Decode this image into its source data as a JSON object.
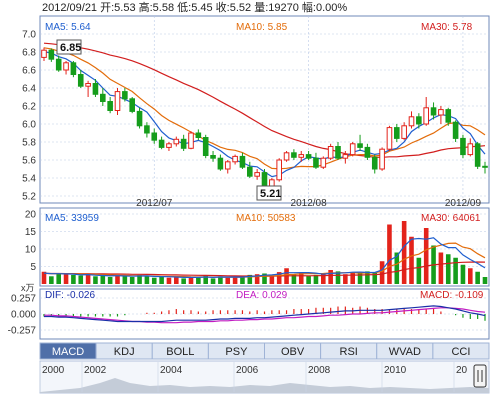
{
  "header": {
    "text": "2012/09/21 开:5.53 高:5.58 低:5.45 收:5.52 量:19270 幅:0.00%"
  },
  "colors": {
    "up": "#e3231b",
    "down": "#159d1b",
    "ma5": "#1f5fcf",
    "ma10": "#e36c0a",
    "ma30": "#d21e1e",
    "dif": "#1a2fa8",
    "dea": "#c21cc2",
    "grid": "#b9c9e6",
    "axis": "#6f88b8"
  },
  "chart_data": [
    {
      "type": "candlestick",
      "name": "price",
      "ma_labels": {
        "ma5": "MA5: 5.64",
        "ma10": "MA10: 5.85",
        "ma30": "MA30: 5.78"
      },
      "ylim": [
        5.2,
        7.0
      ],
      "yticks": [
        "7.0",
        "6.8",
        "6.6",
        "6.4",
        "6.2",
        "6.0",
        "5.8",
        "5.6",
        "5.4",
        "5.2"
      ],
      "xticks": [
        "2012/07",
        "2012/08",
        "2012/09"
      ],
      "annotations": {
        "high": "6.85",
        "low": "5.21"
      },
      "candles": [
        [
          6.74,
          6.85,
          6.7,
          6.82
        ],
        [
          6.82,
          6.84,
          6.69,
          6.72
        ],
        [
          6.72,
          6.76,
          6.58,
          6.6
        ],
        [
          6.6,
          6.7,
          6.55,
          6.68
        ],
        [
          6.68,
          6.7,
          6.52,
          6.55
        ],
        [
          6.55,
          6.6,
          6.4,
          6.42
        ],
        [
          6.42,
          6.48,
          6.3,
          6.45
        ],
        [
          6.45,
          6.5,
          6.3,
          6.33
        ],
        [
          6.33,
          6.4,
          6.2,
          6.25
        ],
        [
          6.25,
          6.3,
          6.12,
          6.15
        ],
        [
          6.15,
          6.4,
          6.1,
          6.36
        ],
        [
          6.36,
          6.4,
          6.25,
          6.28
        ],
        [
          6.28,
          6.3,
          6.12,
          6.14
        ],
        [
          6.14,
          6.18,
          5.95,
          5.98
        ],
        [
          5.98,
          6.02,
          5.85,
          5.9
        ],
        [
          5.9,
          5.95,
          5.78,
          5.82
        ],
        [
          5.82,
          5.86,
          5.72,
          5.74
        ],
        [
          5.74,
          5.8,
          5.7,
          5.78
        ],
        [
          5.78,
          5.86,
          5.75,
          5.83
        ],
        [
          5.83,
          5.88,
          5.7,
          5.73
        ],
        [
          5.73,
          5.92,
          5.72,
          5.9
        ],
        [
          5.9,
          5.94,
          5.82,
          5.85
        ],
        [
          5.85,
          5.88,
          5.62,
          5.65
        ],
        [
          5.65,
          5.7,
          5.58,
          5.62
        ],
        [
          5.62,
          5.66,
          5.48,
          5.5
        ],
        [
          5.5,
          5.6,
          5.45,
          5.58
        ],
        [
          5.58,
          5.66,
          5.55,
          5.64
        ],
        [
          5.64,
          5.68,
          5.5,
          5.52
        ],
        [
          5.52,
          5.58,
          5.4,
          5.42
        ],
        [
          5.42,
          5.5,
          5.38,
          5.46
        ],
        [
          5.46,
          5.5,
          5.28,
          5.3
        ],
        [
          5.3,
          5.4,
          5.21,
          5.38
        ],
        [
          5.38,
          5.62,
          5.36,
          5.6
        ],
        [
          5.6,
          5.7,
          5.58,
          5.68
        ],
        [
          5.68,
          5.72,
          5.6,
          5.63
        ],
        [
          5.63,
          5.7,
          5.58,
          5.66
        ],
        [
          5.66,
          5.7,
          5.6,
          5.62
        ],
        [
          5.62,
          5.68,
          5.5,
          5.52
        ],
        [
          5.52,
          5.64,
          5.5,
          5.62
        ],
        [
          5.62,
          5.78,
          5.6,
          5.75
        ],
        [
          5.75,
          5.8,
          5.6,
          5.62
        ],
        [
          5.62,
          5.7,
          5.56,
          5.66
        ],
        [
          5.66,
          5.8,
          5.64,
          5.78
        ],
        [
          5.78,
          5.88,
          5.7,
          5.74
        ],
        [
          5.74,
          5.78,
          5.6,
          5.63
        ],
        [
          5.63,
          5.66,
          5.45,
          5.5
        ],
        [
          5.5,
          5.74,
          5.48,
          5.72
        ],
        [
          5.72,
          5.98,
          5.7,
          5.96
        ],
        [
          5.96,
          6.0,
          5.8,
          5.84
        ],
        [
          5.84,
          6.02,
          5.82,
          5.98
        ],
        [
          5.98,
          6.14,
          5.95,
          6.08
        ],
        [
          6.08,
          6.12,
          5.95,
          6.0
        ],
        [
          6.0,
          6.3,
          5.98,
          6.18
        ],
        [
          6.18,
          6.24,
          6.05,
          6.1
        ],
        [
          6.1,
          6.2,
          6.0,
          6.16
        ],
        [
          6.16,
          6.18,
          5.98,
          6.02
        ],
        [
          6.02,
          6.04,
          5.8,
          5.84
        ],
        [
          5.84,
          5.88,
          5.62,
          5.66
        ],
        [
          5.66,
          5.84,
          5.64,
          5.78
        ],
        [
          5.78,
          5.8,
          5.5,
          5.53
        ],
        [
          5.53,
          5.58,
          5.45,
          5.52
        ]
      ]
    },
    {
      "type": "bar",
      "name": "volume",
      "unit": "x万",
      "ma_labels": {
        "ma5": "MA5: 33959",
        "ma10": "MA10: 50583",
        "ma30": "MA30: 64061"
      },
      "ylim": [
        0,
        20
      ],
      "yticks": [
        "20",
        "15",
        "10",
        "5"
      ],
      "values": [
        3.5,
        2.2,
        3.0,
        2.8,
        2.6,
        2.4,
        2.6,
        2.2,
        2.4,
        2.0,
        2.6,
        2.2,
        2.0,
        2.6,
        2.2,
        1.8,
        2.0,
        1.8,
        2.2,
        1.6,
        2.0,
        1.8,
        2.4,
        1.6,
        2.2,
        1.8,
        2.0,
        2.2,
        2.6,
        2.8,
        3.0,
        2.4,
        3.4,
        4.5,
        2.8,
        3.2,
        2.4,
        2.6,
        3.0,
        4.0,
        3.6,
        2.8,
        3.4,
        3.2,
        3.6,
        3.4,
        6.5,
        17.0,
        9.0,
        18.0,
        13.5,
        7.5,
        16.0,
        11.0,
        9.0,
        8.5,
        7.5,
        5.5,
        4.5,
        3.5,
        2.0
      ]
    },
    {
      "type": "macd",
      "name": "macd",
      "labels": {
        "dif": "DIF: -0.026",
        "dea": "DEA: 0.029",
        "macd": "MACD: -0.109"
      },
      "ylim": [
        -0.257,
        0.257
      ],
      "yticks": [
        "0.257",
        "0.000",
        "-0.257"
      ],
      "dif": [
        -0.04,
        -0.04,
        -0.05,
        -0.05,
        -0.06,
        -0.07,
        -0.08,
        -0.09,
        -0.1,
        -0.11,
        -0.12,
        -0.12,
        -0.12,
        -0.12,
        -0.12,
        -0.12,
        -0.12,
        -0.11,
        -0.1,
        -0.1,
        -0.1,
        -0.1,
        -0.1,
        -0.09,
        -0.08,
        -0.08,
        -0.07,
        -0.07,
        -0.07,
        -0.06,
        -0.06,
        -0.05,
        -0.04,
        -0.03,
        -0.02,
        -0.01,
        0.0,
        0.01,
        0.02,
        0.03,
        0.04,
        0.05,
        0.05,
        0.06,
        0.06,
        0.06,
        0.06,
        0.07,
        0.08,
        0.09,
        0.1,
        0.11,
        0.12,
        0.13,
        0.12,
        0.1,
        0.08,
        0.05,
        0.02,
        0.0,
        -0.026
      ],
      "dea": [
        -0.02,
        -0.02,
        -0.03,
        -0.03,
        -0.04,
        -0.05,
        -0.06,
        -0.07,
        -0.08,
        -0.09,
        -0.1,
        -0.11,
        -0.12,
        -0.12,
        -0.13,
        -0.13,
        -0.14,
        -0.14,
        -0.14,
        -0.13,
        -0.13,
        -0.12,
        -0.12,
        -0.12,
        -0.11,
        -0.11,
        -0.1,
        -0.1,
        -0.09,
        -0.09,
        -0.08,
        -0.08,
        -0.07,
        -0.06,
        -0.06,
        -0.05,
        -0.04,
        -0.04,
        -0.03,
        -0.02,
        -0.02,
        -0.01,
        0.0,
        0.0,
        0.01,
        0.02,
        0.02,
        0.03,
        0.04,
        0.05,
        0.06,
        0.07,
        0.08,
        0.09,
        0.1,
        0.1,
        0.09,
        0.08,
        0.06,
        0.04,
        0.029
      ],
      "macd": [
        -0.04,
        -0.04,
        -0.04,
        -0.04,
        -0.04,
        -0.04,
        -0.04,
        -0.04,
        -0.04,
        -0.04,
        -0.04,
        -0.02,
        0.0,
        0.0,
        0.02,
        0.02,
        0.04,
        0.06,
        0.08,
        0.06,
        0.06,
        0.04,
        0.04,
        0.06,
        0.06,
        0.06,
        0.06,
        0.06,
        0.04,
        0.06,
        0.04,
        0.06,
        0.06,
        0.06,
        0.08,
        0.08,
        0.08,
        0.1,
        0.1,
        0.1,
        0.12,
        0.12,
        0.1,
        0.12,
        0.1,
        0.08,
        0.08,
        0.08,
        0.08,
        0.08,
        0.08,
        0.08,
        0.08,
        0.08,
        0.04,
        0.0,
        -0.02,
        -0.06,
        -0.08,
        -0.08,
        -0.109
      ]
    }
  ],
  "indicator_tabs": [
    "MACD",
    "KDJ",
    "BOLL",
    "PSY",
    "OBV",
    "RSI",
    "WVAD",
    "CCI"
  ],
  "active_tab": "MACD",
  "timeline": {
    "years": [
      "2000",
      "2002",
      "2004",
      "2006",
      "2008",
      "2010",
      "20"
    ]
  }
}
